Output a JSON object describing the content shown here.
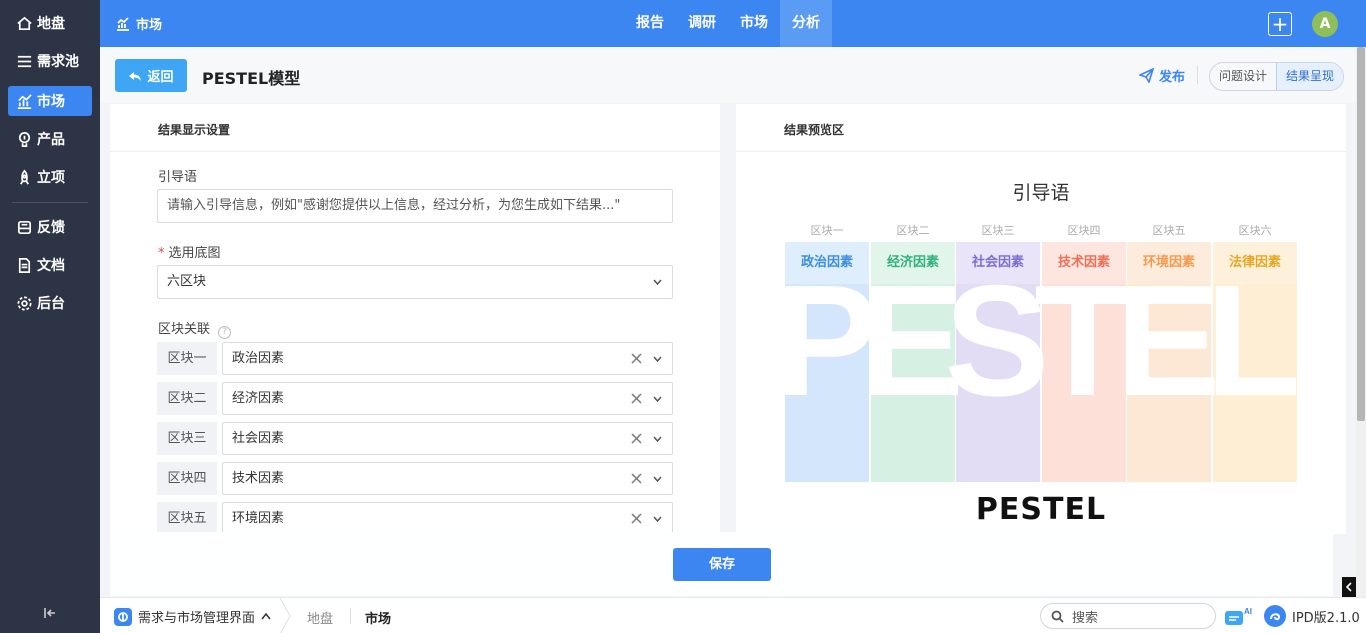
{
  "sidebar": {
    "items": [
      {
        "label": "地盘",
        "icon": "home-icon"
      },
      {
        "label": "需求池",
        "icon": "list-icon"
      },
      {
        "label": "市场",
        "icon": "chart-icon"
      },
      {
        "label": "产品",
        "icon": "lightbulb-icon"
      },
      {
        "label": "立项",
        "icon": "rocket-icon"
      },
      {
        "label": "反馈",
        "icon": "feedback-icon"
      },
      {
        "label": "文档",
        "icon": "document-icon"
      },
      {
        "label": "后台",
        "icon": "gear-icon"
      }
    ],
    "active": "市场"
  },
  "topbar": {
    "title": "市场",
    "tabs": [
      "报告",
      "调研",
      "市场",
      "分析"
    ],
    "active_tab": "分析",
    "avatar_letter": "A"
  },
  "subheader": {
    "back_label": "返回",
    "page_title": "PESTEL模型",
    "publish_label": "发布",
    "segments": [
      "问题设计",
      "结果呈现"
    ],
    "active_segment": "结果呈现"
  },
  "settings": {
    "heading": "结果显示设置",
    "guide_label": "引导语",
    "guide_placeholder": "请输入引导信息，例如\"感谢您提供以上信息，经过分析，为您生成如下结果...\"",
    "base_label": "选用底图",
    "base_value": "六区块",
    "relation_label": "区块关联",
    "blocks": [
      {
        "tag": "区块一",
        "value": "政治因素"
      },
      {
        "tag": "区块二",
        "value": "经济因素"
      },
      {
        "tag": "区块三",
        "value": "社会因素"
      },
      {
        "tag": "区块四",
        "value": "技术因素"
      },
      {
        "tag": "区块五",
        "value": "环境因素"
      }
    ],
    "save_label": "保存"
  },
  "preview": {
    "heading": "结果预览区",
    "title": "引导语",
    "columns": [
      {
        "label": "区块一",
        "name": "政治因素",
        "text_color": "#3b8de0",
        "bg": "#d3e6fb",
        "head_bg": "#dfeefc"
      },
      {
        "label": "区块二",
        "name": "经济因素",
        "text_color": "#2fb27a",
        "bg": "#d6f0e3",
        "head_bg": "#e2f5eb"
      },
      {
        "label": "区块三",
        "name": "社会因素",
        "text_color": "#7b6fd0",
        "bg": "#e2dcf5",
        "head_bg": "#e9e4f8"
      },
      {
        "label": "区块四",
        "name": "技术因素",
        "text_color": "#ee6f55",
        "bg": "#fde0d8",
        "head_bg": "#fde6e0"
      },
      {
        "label": "区块五",
        "name": "环境因素",
        "text_color": "#f39a4d",
        "bg": "#fde8d5",
        "head_bg": "#fdebdc"
      },
      {
        "label": "区块六",
        "name": "法律因素",
        "text_color": "#e6a623",
        "bg": "#fdeed4",
        "head_bg": "#fdf1dc"
      }
    ],
    "letters": [
      "P",
      "E",
      "S",
      "T",
      "E",
      "L"
    ],
    "bottom_title": "PESTEL"
  },
  "statusbar": {
    "app_name": "需求与市场管理界面",
    "crumbs": [
      "地盘",
      "市场"
    ],
    "search_placeholder": "搜索",
    "ai_label": "AI",
    "version": "IPD版2.1.0"
  },
  "colors": {
    "primary": "#3b86f0",
    "sidebar_bg": "#2d3445"
  }
}
